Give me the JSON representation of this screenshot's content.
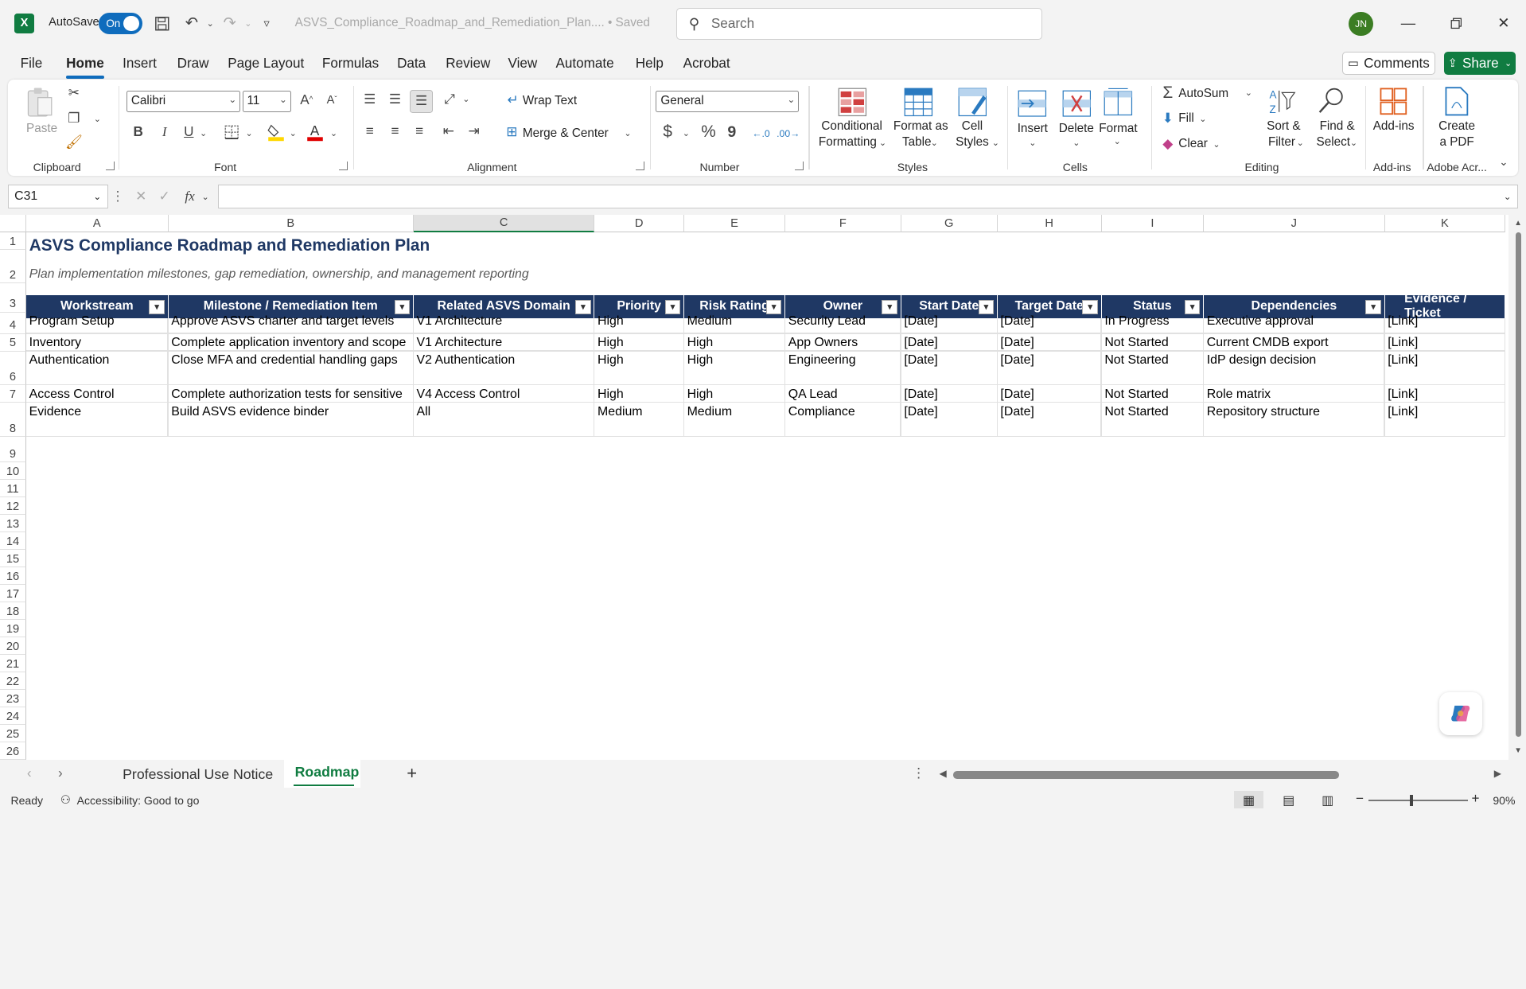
{
  "titlebar": {
    "app_icon": "X",
    "autosave_label": "AutoSave",
    "autosave_state": "On",
    "doc_name": "ASVS_Compliance_Roadmap_and_Remediation_Plan.... • Saved",
    "search_placeholder": "Search",
    "avatar_initials": "JN"
  },
  "menu": {
    "items": [
      "File",
      "Home",
      "Insert",
      "Draw",
      "Page Layout",
      "Formulas",
      "Data",
      "Review",
      "View",
      "Automate",
      "Help",
      "Acrobat"
    ],
    "active": "Home",
    "comments_label": "Comments",
    "share_label": "Share"
  },
  "ribbon": {
    "clipboard": {
      "label": "Clipboard",
      "paste": "Paste"
    },
    "font": {
      "label": "Font",
      "family": "Calibri",
      "size": "11",
      "bold": "B",
      "italic": "I",
      "underline": "U"
    },
    "alignment": {
      "label": "Alignment",
      "wrap_text": "Wrap Text",
      "merge_center": "Merge & Center"
    },
    "number": {
      "label": "Number",
      "format": "General",
      "currency": "$",
      "percent": "%",
      "comma": "9"
    },
    "styles": {
      "label": "Styles",
      "conditional": "Conditional",
      "conditional2": "Formatting",
      "format_as": "Format as",
      "format_as2": "Table",
      "cell": "Cell",
      "cell2": "Styles"
    },
    "cells": {
      "label": "Cells",
      "insert": "Insert",
      "delete": "Delete",
      "format": "Format"
    },
    "editing": {
      "label": "Editing",
      "autosum": "AutoSum",
      "fill": "Fill",
      "clear": "Clear",
      "sort": "Sort &",
      "sort2": "Filter",
      "find": "Find &",
      "find2": "Select"
    },
    "addins": {
      "label": "Add-ins",
      "addins": "Add-ins"
    },
    "adobe": {
      "label": "Adobe Acr...",
      "create": "Create",
      "create2": "a PDF"
    }
  },
  "formula_bar": {
    "name_box": "C31",
    "fx": "fx",
    "value": ""
  },
  "sheet": {
    "columns": [
      "A",
      "B",
      "C",
      "D",
      "E",
      "F",
      "G",
      "H",
      "I",
      "J",
      "K"
    ],
    "rows": [
      "1",
      "2",
      "3",
      "4",
      "5",
      "6",
      "7",
      "8",
      "9",
      "10",
      "11",
      "12",
      "13",
      "14",
      "15",
      "16",
      "17",
      "18",
      "19",
      "20",
      "21",
      "22",
      "23",
      "24",
      "25",
      "26"
    ],
    "title": "ASVS Compliance Roadmap and Remediation Plan",
    "subtitle": "Plan implementation milestones, gap remediation, ownership, and management reporting",
    "headers": [
      "Workstream",
      "Milestone / Remediation Item",
      "Related ASVS Domain",
      "Priority",
      "Risk Rating",
      "Owner",
      "Start Date",
      "Target Date",
      "Status",
      "Dependencies",
      "Evidence / Ticket"
    ],
    "data": [
      [
        "Program Setup",
        "Approve ASVS charter and target levels",
        "V1 Architecture",
        "High",
        "Medium",
        "Security Lead",
        "[Date]",
        "[Date]",
        "In Progress",
        "Executive approval",
        "[Link]"
      ],
      [
        "Inventory",
        "Complete application inventory and scope classification",
        "V1 Architecture",
        "High",
        "High",
        "App Owners",
        "[Date]",
        "[Date]",
        "Not Started",
        "Current CMDB export",
        "[Link]"
      ],
      [
        "Authentication",
        "Close MFA and credential handling gaps",
        "V2 Authentication",
        "High",
        "High",
        "Engineering",
        "[Date]",
        "[Date]",
        "Not Started",
        "IdP design decision",
        "[Link]"
      ],
      [
        "Access Control",
        "Complete authorization tests for sensitive workflows",
        "V4 Access Control",
        "High",
        "High",
        "QA Lead",
        "[Date]",
        "[Date]",
        "Not Started",
        "Role matrix",
        "[Link]"
      ],
      [
        "Evidence",
        "Build ASVS evidence binder",
        "All",
        "Medium",
        "Medium",
        "Compliance",
        "[Date]",
        "[Date]",
        "Not Started",
        "Repository structure",
        "[Link]"
      ]
    ]
  },
  "tabs": {
    "sheets": [
      "Professional Use Notice",
      "Roadmap"
    ],
    "active": "Roadmap",
    "add": "+"
  },
  "status": {
    "ready": "Ready",
    "accessibility": "Accessibility: Good to go",
    "zoom": "90%"
  },
  "colors": {
    "accent": "#107c41",
    "header_fill": "#1f3864",
    "brand_blue": "#0f6cbd"
  }
}
